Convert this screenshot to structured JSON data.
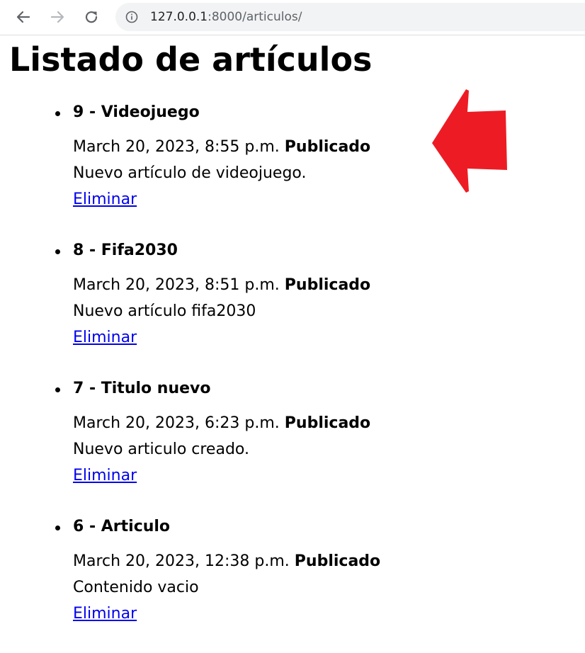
{
  "browser": {
    "url_host": "127.0.0.1",
    "url_rest": ":8000/articulos/"
  },
  "page": {
    "title": "Listado de artículos"
  },
  "articles": [
    {
      "heading": "9 - Videojuego",
      "date": "March 20, 2023, 8:55 p.m.",
      "status": "Publicado",
      "content": "Nuevo artículo de videojuego.",
      "delete_label": "Eliminar"
    },
    {
      "heading": "8 - Fifa2030",
      "date": "March 20, 2023, 8:51 p.m.",
      "status": "Publicado",
      "content": "Nuevo artículo fifa2030",
      "delete_label": "Eliminar"
    },
    {
      "heading": "7 - Titulo nuevo",
      "date": "March 20, 2023, 6:23 p.m.",
      "status": "Publicado",
      "content": "Nuevo articulo creado.",
      "delete_label": "Eliminar"
    },
    {
      "heading": "6 - Articulo",
      "date": "March 20, 2023, 12:38 p.m.",
      "status": "Publicado",
      "content": "Contenido vacio",
      "delete_label": "Eliminar"
    }
  ],
  "colors": {
    "link": "#0000ee",
    "annotation_arrow": "#ed1c24",
    "omnibox_bg": "#f1f3f4"
  },
  "icons": [
    "back-arrow-icon",
    "forward-arrow-icon",
    "reload-icon",
    "info-icon",
    "red-arrow-annotation"
  ]
}
